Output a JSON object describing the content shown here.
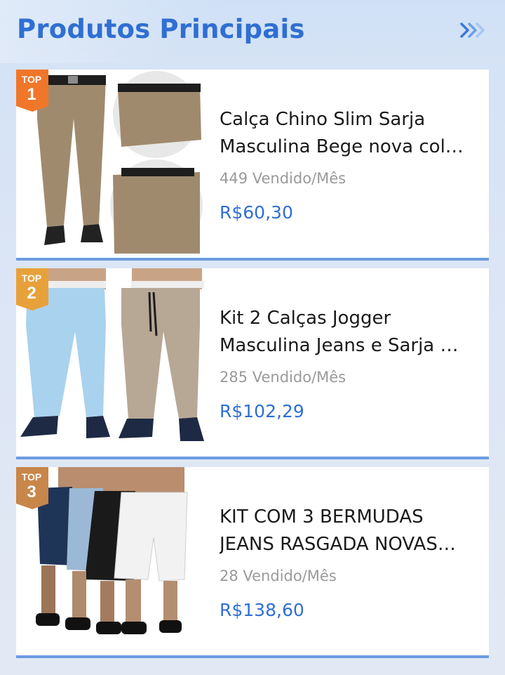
{
  "header": {
    "title": "Produtos Principais",
    "more_icon": "double-chevron-right-icon",
    "accent": "#2f6fd3"
  },
  "products": [
    {
      "badge_top": "TOP",
      "rank": "1",
      "badge_color": "#f0762a",
      "title_line1": "Calça Chino Slim Sarja",
      "title_line2": "Masculina Bege nova col…",
      "sold": "449 Vendido/Mês",
      "price": "R$60,30"
    },
    {
      "badge_top": "TOP",
      "rank": "2",
      "badge_color": "#e8a13a",
      "title_line1": "Kit 2 Calças Jogger",
      "title_line2": "Masculina Jeans e Sarja …",
      "sold": "285 Vendido/Mês",
      "price": "R$102,29"
    },
    {
      "badge_top": "TOP",
      "rank": "3",
      "badge_color": "#c8864a",
      "title_line1": "KIT COM 3 BERMUDAS",
      "title_line2": "JEANS RASGADA NOVAS…",
      "sold": "28 Vendido/Mês",
      "price": "R$138,60"
    }
  ]
}
